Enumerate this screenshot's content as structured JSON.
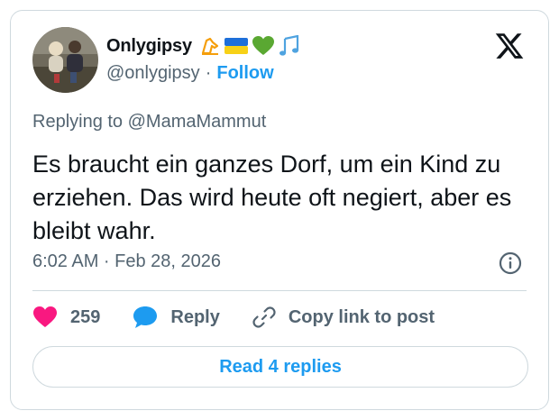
{
  "author": {
    "name": "Onlygipsy",
    "handle": "@onlygipsy",
    "separator": "·",
    "follow_label": "Follow",
    "name_emojis": [
      "carousel-horse-emoji",
      "ukraine-flag-emoji",
      "green-heart-emoji",
      "music-notes-emoji"
    ]
  },
  "reply_context": "Replying to @MamaMammut",
  "tweet": {
    "text": "Es braucht ein ganzes Dorf, um ein Kind zu erziehen. Das wird heute oft negiert, aber es bleibt wahr.",
    "timestamp": "6:02 AM · Feb 28, 2026"
  },
  "actions": {
    "likes_count": "259",
    "reply_label": "Reply",
    "copy_link_label": "Copy link to post"
  },
  "read_replies_label": "Read 4 replies",
  "colors": {
    "accent": "#1d9bf0",
    "heart": "#f91880",
    "muted": "#536471",
    "border": "#cfd9de"
  }
}
